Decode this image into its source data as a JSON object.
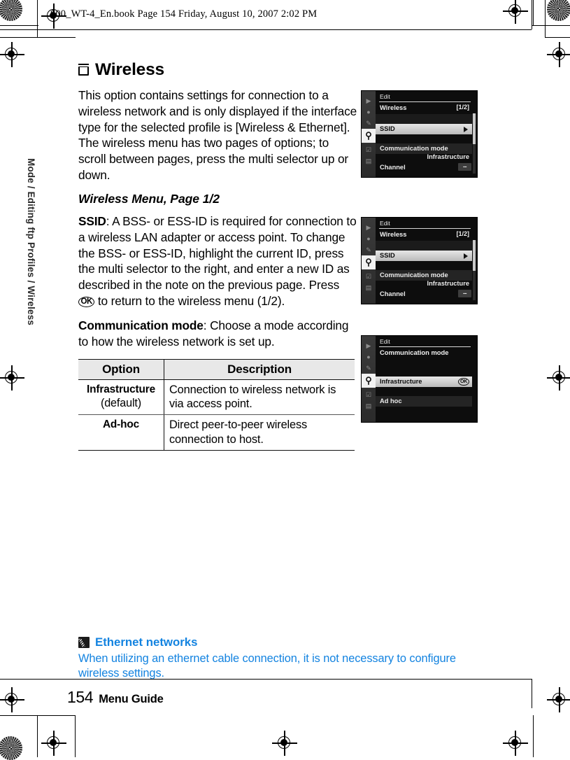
{
  "print_header": {
    "text": "$00_WT-4_En.book  Page 154  Friday, August 10, 2007  2:02 PM"
  },
  "running_head": {
    "text": "Mode / Editing ftp Profiles / Wireless"
  },
  "section": {
    "icon": "menu-square-icon",
    "title": "Wireless",
    "intro": "This option contains settings for connection to a wireless network and is only displayed if the interface type for the selected profile is [Wireless & Ethernet].  The wireless menu has two pages of options; to scroll between pages, press the multi selector up or down.",
    "subheading": "Wireless Menu, Page 1/2"
  },
  "ssid": {
    "term": "SSID",
    "text_before_ok": ": A BSS- or ESS-ID is required for connection to a wireless LAN adapter or access point.  To change the BSS- or ESS-ID, highlight the current ID, press the multi selector to the right, and enter a new ID as described in the note on the previous page. Press ",
    "ok_glyph": "OK",
    "text_after_ok": " to return to the wireless menu (1/2)."
  },
  "comm_mode": {
    "term": "Communication mode",
    "text": ": Choose a mode according to how the wireless network is set up."
  },
  "table": {
    "headers": [
      "Option",
      "Description"
    ],
    "rows": [
      {
        "option": "Infrastructure",
        "option_note": "(default)",
        "description": "Connection to wireless network is via access point."
      },
      {
        "option": "Ad-hoc",
        "option_note": "",
        "description": "Direct peer-to-peer wireless connection to host."
      }
    ]
  },
  "screenshots": [
    {
      "id": "wireless-menu-1",
      "rail_icons": [
        "playback-icon",
        "shooting-menu-icon",
        "custom-settings-icon",
        "setup-wrench-icon",
        "retouch-icon",
        "recent-settings-icon"
      ],
      "rail_selected_index": 3,
      "title": "Edit",
      "row_label": "Wireless",
      "page_indicator": "[1/2]",
      "selected_item": "SSID",
      "selected_arrow": "chevron-right-icon",
      "item2_label": "Communication mode",
      "item2_value": "Infrastructure",
      "item3_label": "Channel",
      "item3_value": "--"
    },
    {
      "id": "wireless-menu-2",
      "rail_icons": [
        "playback-icon",
        "shooting-menu-icon",
        "custom-settings-icon",
        "setup-wrench-icon",
        "retouch-icon",
        "recent-settings-icon"
      ],
      "rail_selected_index": 3,
      "title": "Edit",
      "row_label": "Wireless",
      "page_indicator": "[1/2]",
      "selected_item": "SSID",
      "selected_arrow": "chevron-right-icon",
      "item2_label": "Communication mode",
      "item2_value": "Infrastructure",
      "item3_label": "Channel",
      "item3_value": "--"
    },
    {
      "id": "communication-mode-menu",
      "title": "Edit",
      "row_label": "Communication mode",
      "selected_item": "Infrastructure",
      "ok_badge": "OK",
      "other_item": "Ad hoc"
    }
  ],
  "note": {
    "icon": "pencil-icon",
    "heading": "Ethernet networks",
    "body": "When utilizing an ethernet cable connection, it is not necessary to configure wireless settings."
  },
  "footer": {
    "page_number": "154",
    "title": "Menu Guide"
  },
  "colors": {
    "note_blue": "#1383e0",
    "table_header_bg": "#e8e8e8",
    "screen_bg": "#0d0d0d"
  }
}
